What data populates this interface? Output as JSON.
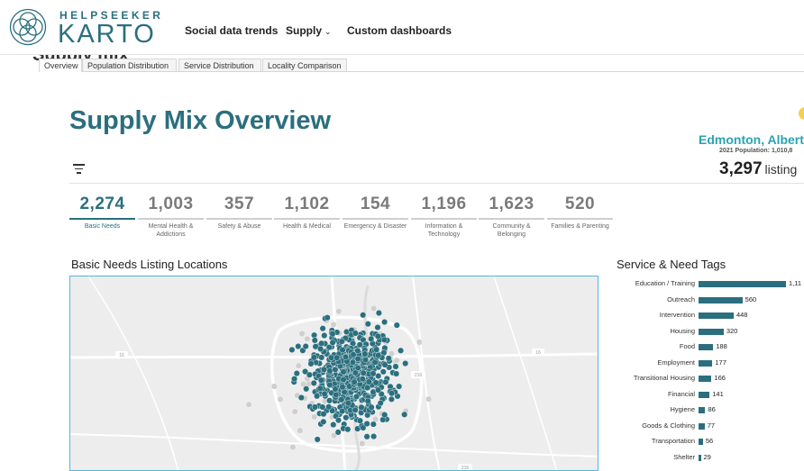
{
  "brand": {
    "top": "HELPSEEKER",
    "main": "KARTO"
  },
  "nav": [
    {
      "label": "Social data trends",
      "dropdown": false
    },
    {
      "label": "Supply",
      "dropdown": true
    },
    {
      "label": "Custom dashboards",
      "dropdown": false
    }
  ],
  "ghost_title": "Supply mix",
  "tabs": [
    {
      "label": "Overview",
      "active": true
    },
    {
      "label": "Population Distribution",
      "active": false
    },
    {
      "label": "Service Distribution",
      "active": false
    },
    {
      "label": "Locality Comparison",
      "active": false
    }
  ],
  "page_title": "Supply Mix Overview",
  "location": {
    "city": "Edmonton, Albert",
    "population": "2021 Population: 1,010,8",
    "listings": "3,297",
    "listings_label": "listing"
  },
  "stats": [
    {
      "value": "2,274",
      "label": "Basic Needs",
      "active": true
    },
    {
      "value": "1,003",
      "label": "Mental Health & Addictions",
      "active": false
    },
    {
      "value": "357",
      "label": "Safety & Abuse",
      "active": false
    },
    {
      "value": "1,102",
      "label": "Health & Medical",
      "active": false
    },
    {
      "value": "154",
      "label": "Emergency & Disaster",
      "active": false
    },
    {
      "value": "1,196",
      "label": "Information & Technology",
      "active": false
    },
    {
      "value": "1,623",
      "label": "Community & Belonging",
      "active": false
    },
    {
      "value": "520",
      "label": "Families & Parenting",
      "active": false
    }
  ],
  "map_section": {
    "title": "Basic Needs Listing Locations",
    "road_labels": [
      "16",
      "16",
      "216",
      "216"
    ]
  },
  "tags_section": {
    "title": "Service & Need Tags"
  },
  "colors": {
    "accent": "#2b6f7e",
    "city": "#2aa3b3",
    "map_border": "#55b7d9",
    "point_active": "#2b6f7e",
    "point_inactive": "#cfcfcf"
  },
  "chart_data": {
    "type": "bar",
    "orientation": "horizontal",
    "categories": [
      "Education / Training",
      "Outreach",
      "Intervention",
      "Housing",
      "Food",
      "Employment",
      "Transitional Housing",
      "Financial",
      "Hygiene",
      "Goods & Clothing",
      "Transportation",
      "Shelter"
    ],
    "values": [
      1116,
      560,
      448,
      320,
      188,
      177,
      166,
      141,
      86,
      77,
      56,
      29
    ],
    "value_labels": [
      "1,11",
      "560",
      "448",
      "320",
      "188",
      "177",
      "166",
      "141",
      "86",
      "77",
      "56",
      "29"
    ],
    "xlim": [
      0,
      1116
    ]
  }
}
